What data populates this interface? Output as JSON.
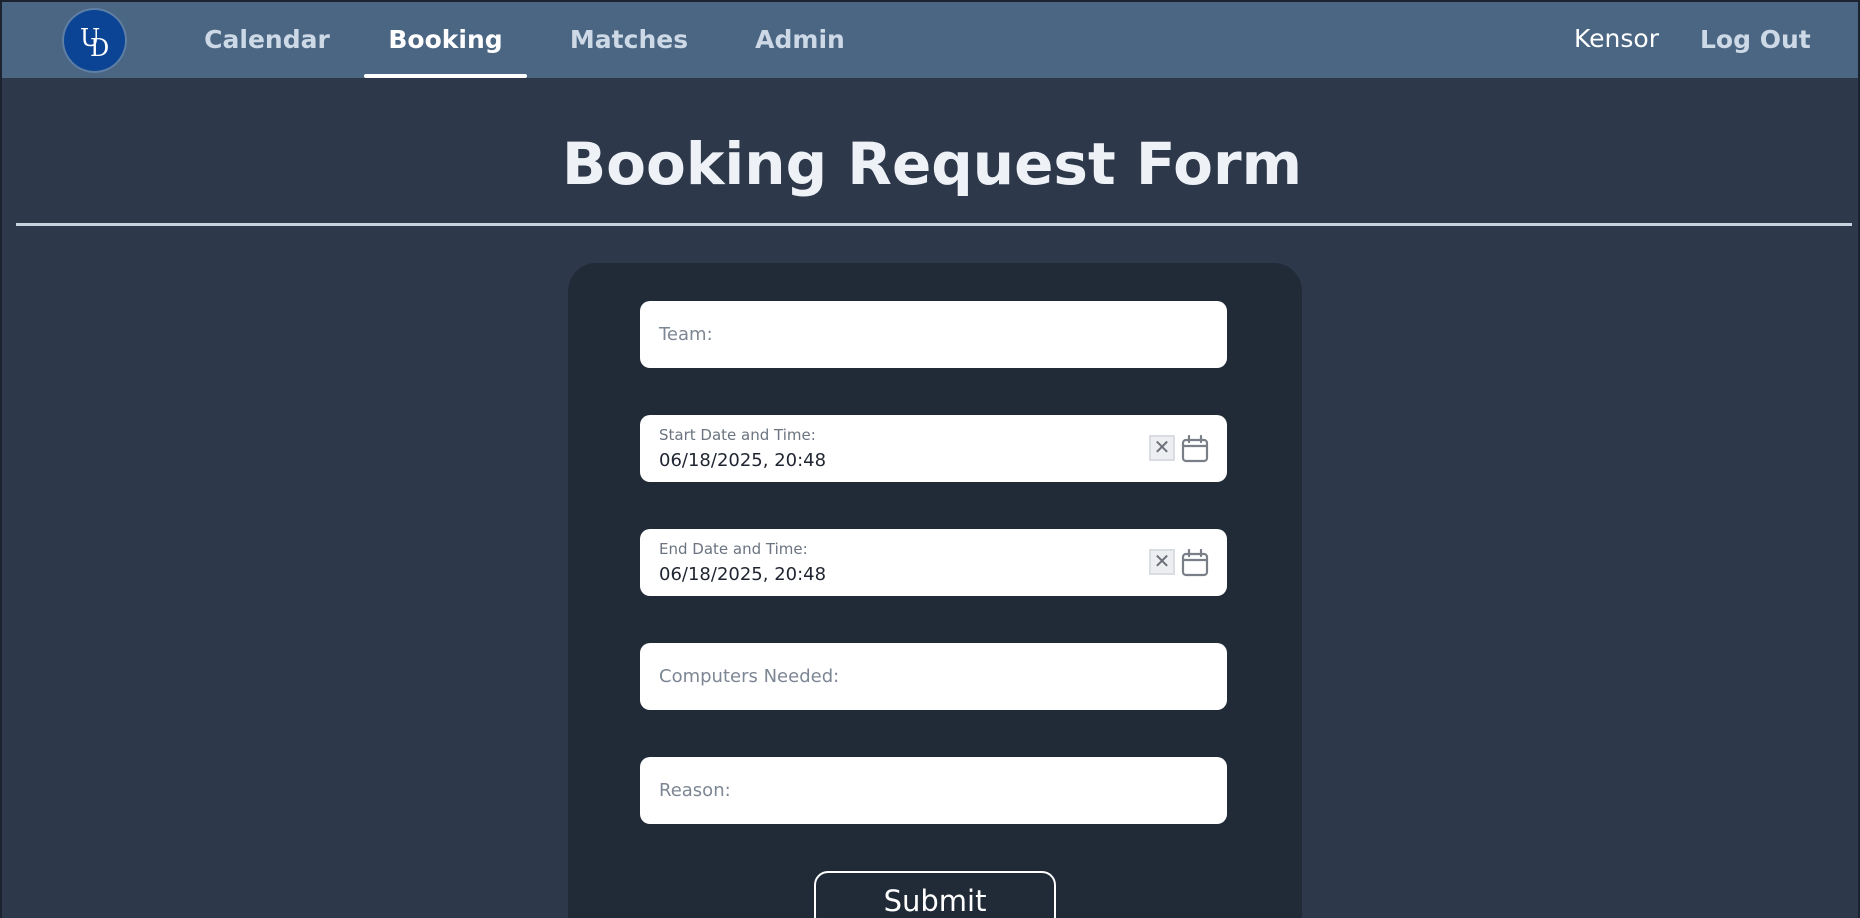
{
  "navbar": {
    "logo_text": "UD",
    "items": [
      {
        "label": "Calendar",
        "active": false
      },
      {
        "label": "Booking",
        "active": true
      },
      {
        "label": "Matches",
        "active": false
      },
      {
        "label": "Admin",
        "active": false
      }
    ],
    "user": "Kensor",
    "logout_label": "Log Out"
  },
  "page": {
    "title": "Booking Request Form"
  },
  "form": {
    "team": {
      "placeholder": "Team:"
    },
    "start": {
      "label": "Start Date and Time:",
      "value": "06/18/2025, 20:48",
      "clear_glyph": "✕"
    },
    "end": {
      "label": "End Date and Time:",
      "value": "06/18/2025, 20:48",
      "clear_glyph": "✕"
    },
    "computers": {
      "placeholder": "Computers Needed:"
    },
    "reason": {
      "placeholder": "Reason:"
    },
    "submit_label": "Submit"
  },
  "colors": {
    "navbar": "#4a6683",
    "background": "#2e384b",
    "card": "#212a37",
    "logo": "#0b4495"
  },
  "icons": {
    "calendar": "calendar-icon",
    "clear": "close-icon"
  }
}
